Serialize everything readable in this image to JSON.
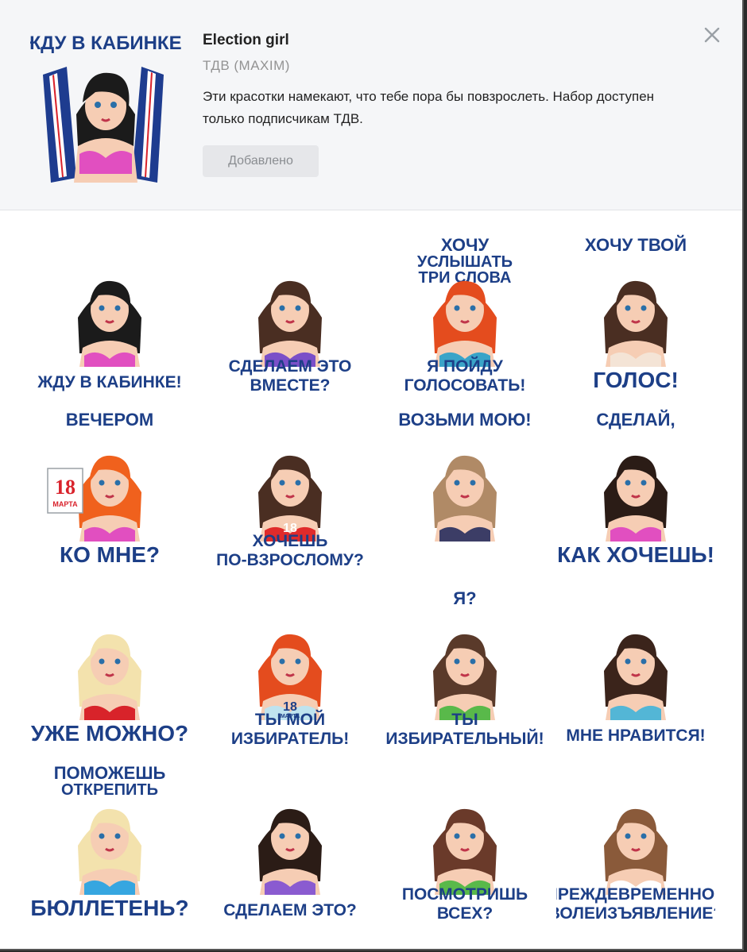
{
  "pack": {
    "title": "Election girl",
    "author": "ТДВ (MAXIM)",
    "description": "Эти красотки намекают, что тебе пора бы повзрослеть. Набор доступен только подписчикам ТДВ.",
    "button_label": "Добавлено",
    "header_sticker_text": "ЖДУ В КАБИНКЕ!"
  },
  "icons": {
    "close": "close-icon"
  },
  "colors": {
    "caption": "#1d3f87",
    "header_bg": "#f5f6f8",
    "button_bg": "#e6e7ea"
  },
  "stickers": [
    {
      "top": "",
      "bottom": "ЖДУ В КАБИНКЕ!",
      "hair": "#1b1b1b",
      "top_color": "#e14fc0",
      "extra": "flags"
    },
    {
      "top": "",
      "bottom": "СДЕЛАЕМ ЭТО",
      "bottom2": "ВМЕСТЕ?",
      "hair": "#4a2e22",
      "top_color": "#7b4fc8"
    },
    {
      "top": "ХОЧУ",
      "top2": "УСЛЫШАТЬ",
      "top3": "ТРИ СЛОВА",
      "bottom": "Я ПОЙДУ",
      "bottom2": "ГОЛОСОВАТЬ!",
      "hair": "#e44c1e",
      "top_color": "#3aa4c8"
    },
    {
      "top": "ХОЧУ ТВОЙ",
      "bottom": "ГОЛОС!",
      "hair": "#4a2e22",
      "top_color": "#f4e4d6"
    },
    {
      "top": "ВЕЧЕРОМ",
      "bottom": "КО МНЕ?",
      "hair": "#f0611d",
      "top_color": "#e14fc0",
      "calendar_num": "18",
      "calendar_month": "МАРТА"
    },
    {
      "top": "",
      "bottom": "ХОЧЕШЬ",
      "bottom2": "ПО-ВЗРОСЛОМУ?",
      "hair": "#4a2e22",
      "top_color": "#e02b2b",
      "shirt_num": "18"
    },
    {
      "top": "ВОЗЬМИ МОЮ!",
      "bottom": "",
      "hair": "#b08a66",
      "top_color": "#3c3d66"
    },
    {
      "top": "СДЕЛАЙ,",
      "bottom": "КАК ХОЧЕШЬ!",
      "hair": "#2b1c16",
      "top_color": "#e14fc0"
    },
    {
      "top": "",
      "bottom": "УЖЕ МОЖНО?",
      "hair": "#f3e2ad",
      "top_color": "#d8232a"
    },
    {
      "top": "",
      "bottom": "ТЫ МОЙ",
      "bottom2": "ИЗБИРАТЕЛЬ!",
      "hair": "#e44c1e",
      "top_color": "#bfe3ef",
      "shirt_num": "18",
      "shirt_month": "МАРТА"
    },
    {
      "top": "Я?",
      "bottom": "ТЫ",
      "bottom2": "ИЗБИРАТЕЛЬНЫЙ!",
      "hair": "#5a3a2a",
      "top_color": "#59b94a"
    },
    {
      "top": "",
      "bottom": "МНЕ НРАВИТСЯ!",
      "hair": "#3b241b",
      "top_color": "#53b6d6"
    },
    {
      "top": "ПОМОЖЕШЬ",
      "top2": "ОТКРЕПИТЬ",
      "bottom": "БЮЛЛЕТЕНЬ?",
      "hair": "#f3e2ad",
      "top_color": "#36a6e0"
    },
    {
      "top": "",
      "bottom": "СДЕЛАЕМ ЭТО?",
      "hair": "#2b1c16",
      "top_color": "#8a5bd0"
    },
    {
      "top": "",
      "bottom": "ПОСМОТРИШЬ",
      "bottom2": "ВСЕХ?",
      "hair": "#6a3a2a",
      "top_color": "#59b94a"
    },
    {
      "top": "",
      "bottom": "ПРЕЖДЕВРЕМЕННОЕ",
      "bottom2": "ВОЛЕИЗЪЯВЛЕНИЕ?",
      "hair": "#8a5a3a",
      "top_color": "#ffffff"
    }
  ]
}
